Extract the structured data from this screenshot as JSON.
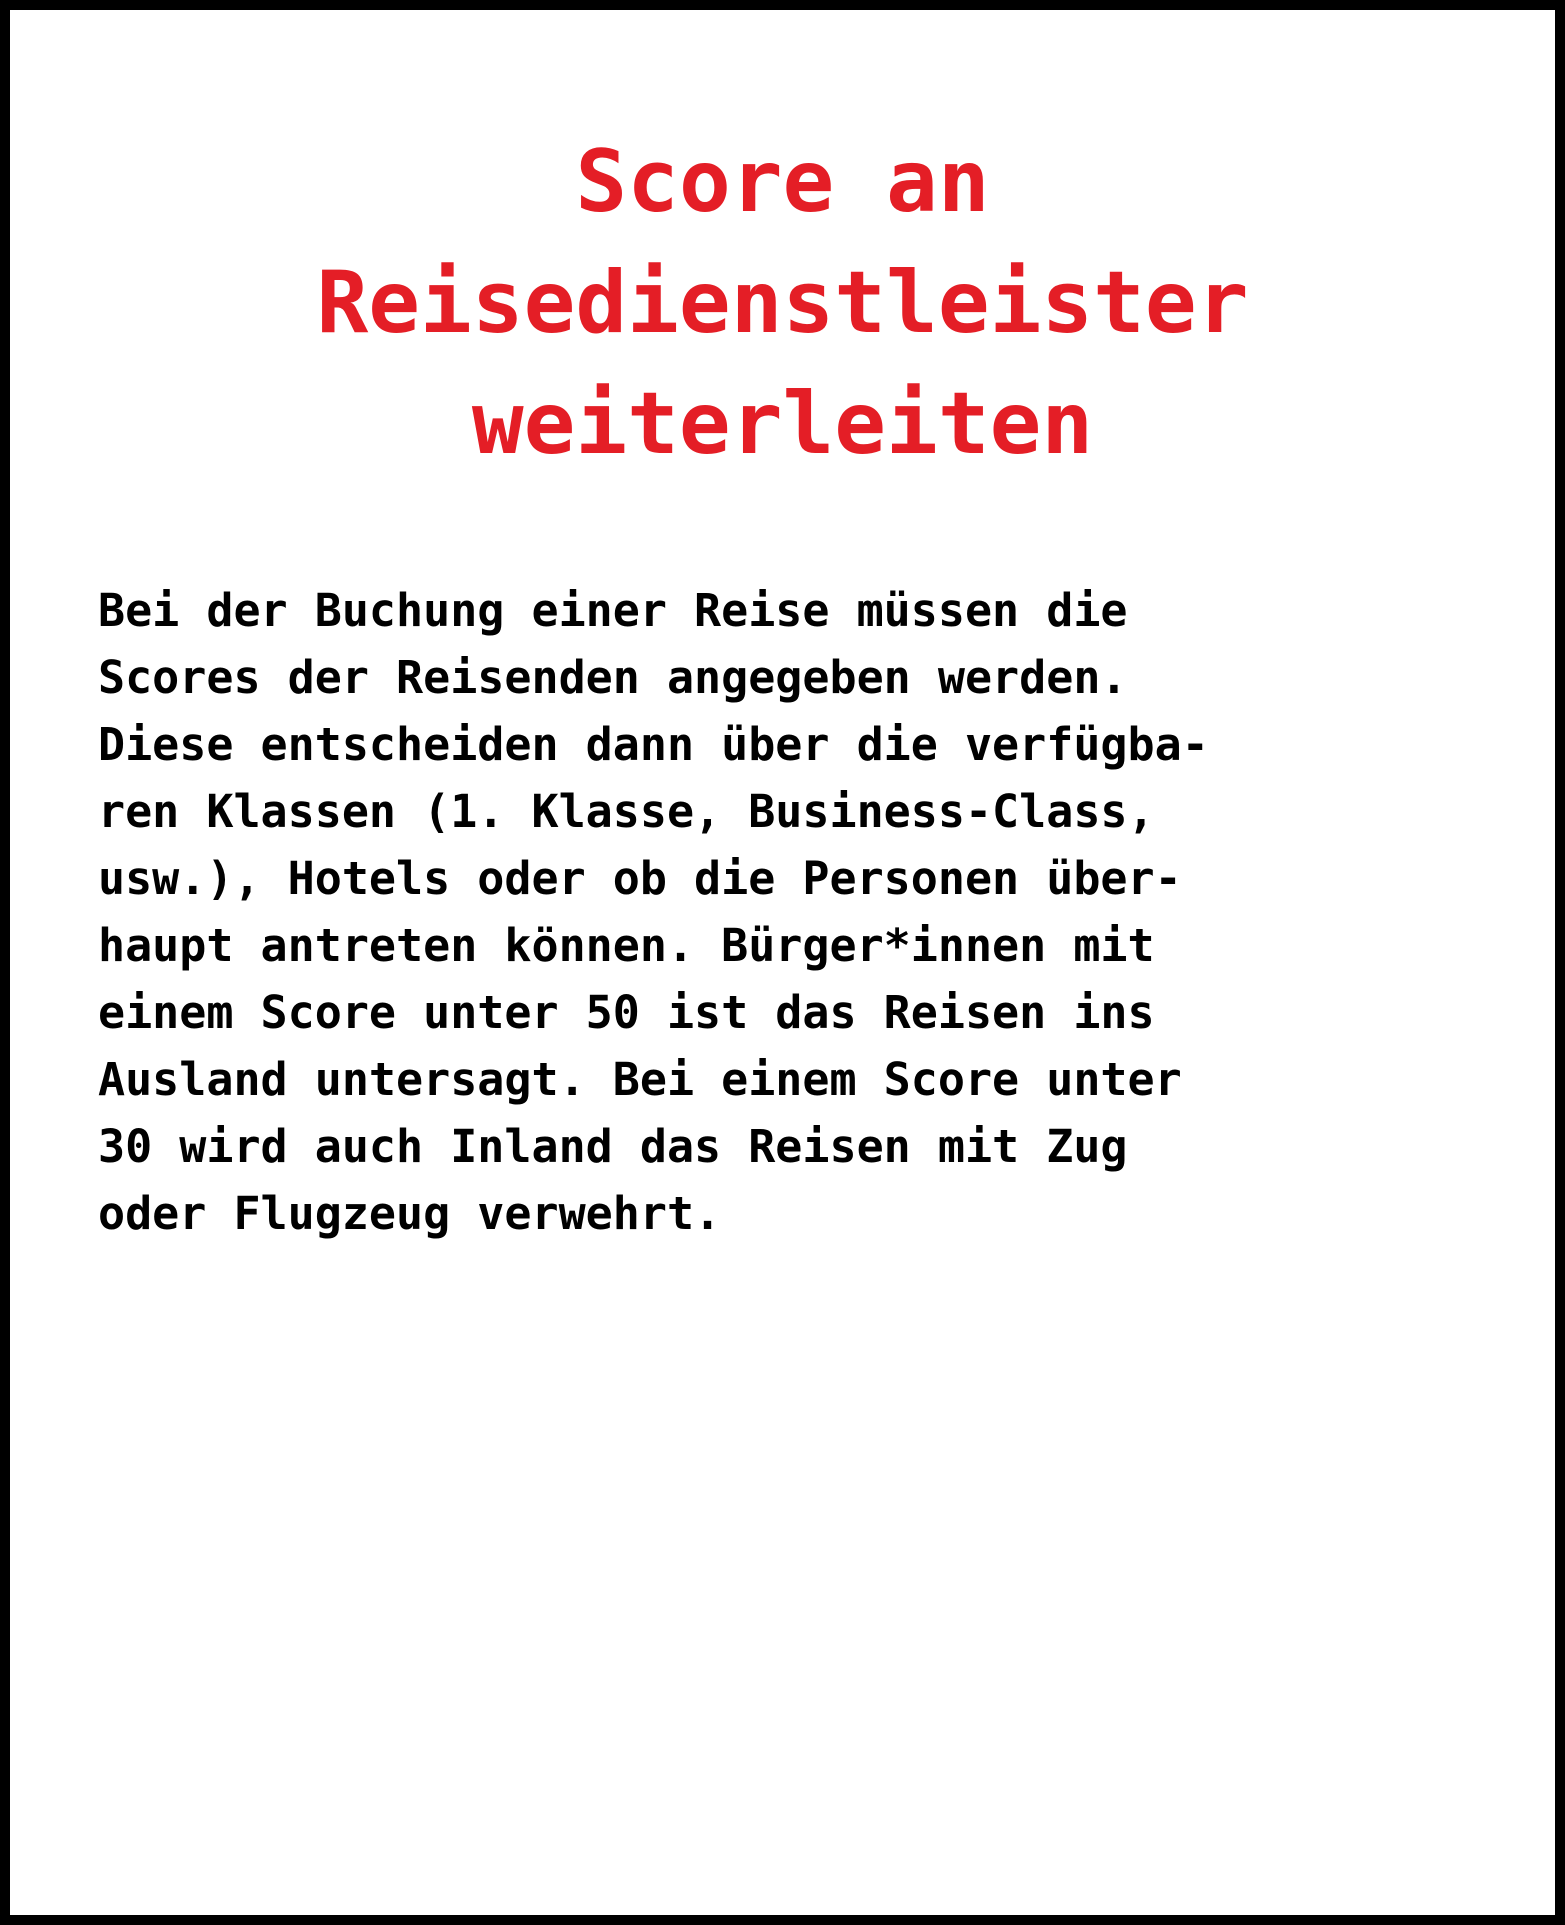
{
  "colors": {
    "title": "#e41e26",
    "text": "#000000",
    "border": "#000000",
    "background": "#ffffff"
  },
  "title_lines": [
    "Score an",
    "Reisedienstleister",
    "weiterleiten"
  ],
  "body_lines": [
    "Bei der Buchung einer Reise müssen die",
    "Scores der Reisenden angegeben werden.",
    "Diese entscheiden dann über die verfügba-",
    "ren Klassen (1. Klasse, Business-Class,",
    "usw.), Hotels oder ob die Personen über-",
    "haupt antreten können. Bürger*innen mit",
    "einem Score unter 50 ist das Reisen ins",
    "Ausland untersagt. Bei einem Score unter",
    "30 wird auch Inland das Reisen mit Zug",
    "oder Flugzeug verwehrt."
  ]
}
